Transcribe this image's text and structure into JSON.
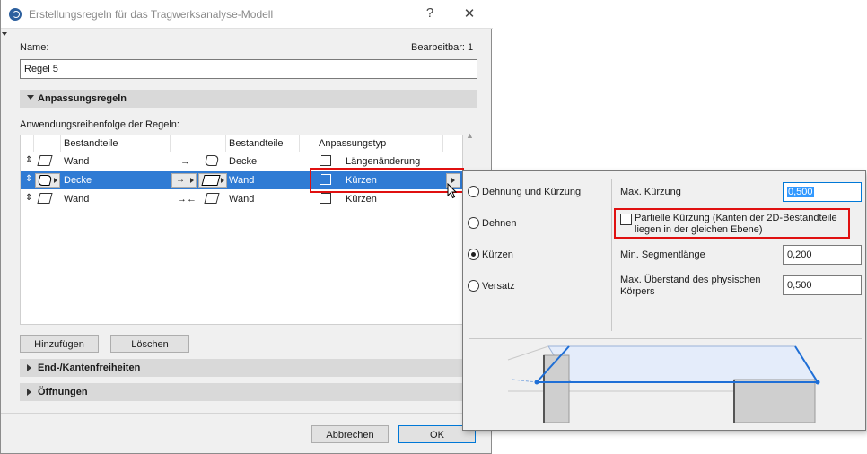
{
  "window": {
    "title": "Erstellungsregeln für das Tragwerksanalyse-Modell",
    "help_label": "?",
    "close_label": "✕"
  },
  "name_field": {
    "label": "Name:",
    "value": "Regel 5",
    "editable_label": "Bearbeitbar: 1"
  },
  "sections": {
    "adjust_rules": "Anpassungsregeln",
    "end_edge": "End-/Kantenfreiheiten",
    "openings": "Öffnungen"
  },
  "rules": {
    "order_label": "Anwendungsreihenfolge der Regeln:",
    "columns": [
      "Bestandteile",
      "Bestandteile",
      "Anpassungstyp"
    ],
    "rows": [
      {
        "left": "Wand",
        "arrow": "→",
        "right": "Decke",
        "type": "Längenänderung",
        "selected": false
      },
      {
        "left": "Decke",
        "arrow": "→",
        "right": "Wand",
        "type": "Kürzen",
        "selected": true
      },
      {
        "left": "Wand",
        "arrow": "→←",
        "right": "Wand",
        "type": "Kürzen",
        "selected": false
      }
    ]
  },
  "buttons": {
    "add": "Hinzufügen",
    "delete": "Löschen",
    "cancel": "Abbrechen",
    "ok": "OK"
  },
  "popup": {
    "options": [
      {
        "label": "Dehnung und Kürzung",
        "checked": false
      },
      {
        "label": "Dehnen",
        "checked": false
      },
      {
        "label": "Kürzen",
        "checked": true
      },
      {
        "label": "Versatz",
        "checked": false
      }
    ],
    "max_shortening_label": "Max. Kürzung",
    "max_shortening_value": "0,500",
    "partial_checkbox_line1": "Partielle Kürzung (Kanten der 2D-Bestandteile",
    "partial_checkbox_line2": "liegen in der gleichen Ebene)",
    "min_segment_label": "Min. Segmentlänge",
    "min_segment_value": "0,200",
    "max_overhang_line1": "Max. Überstand des physischen",
    "max_overhang_line2": "Körpers",
    "max_overhang_value": "0,500"
  },
  "colors": {
    "selection": "#2f7bd4",
    "highlight_box": "#e01010",
    "preview_blue": "#1f6fd6"
  }
}
